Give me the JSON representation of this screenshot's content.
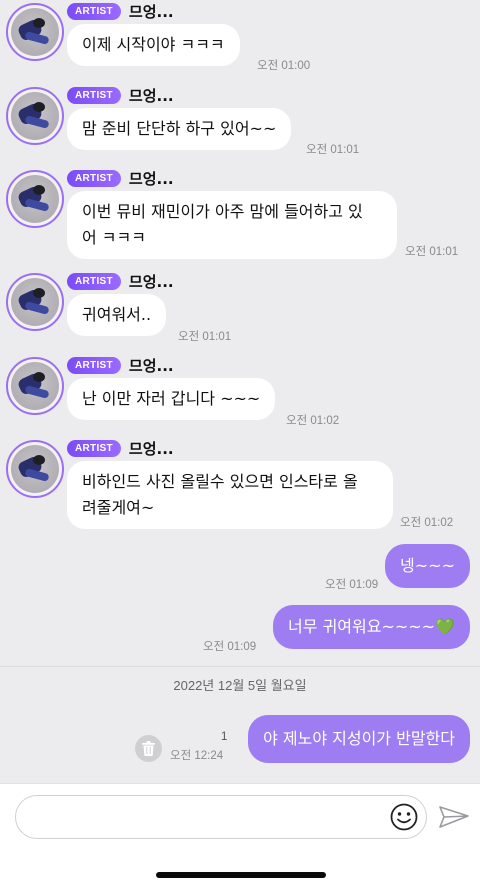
{
  "artist": {
    "badge": "ARTIST",
    "name": "므엉..."
  },
  "messages": [
    {
      "lines": [
        "이제 시작이야 ㅋㅋㅋ"
      ],
      "time": "오전 01:00"
    },
    {
      "lines": [
        "맘 준비 단단하 하구 있어~~"
      ],
      "time": "오전 01:01"
    },
    {
      "lines": [
        "이번 뮤비 재민이가 아주 맘에 들어하고 있",
        "어 ㅋㅋㅋ"
      ],
      "time": "오전 01:01"
    },
    {
      "lines": [
        "귀여워서.."
      ],
      "time": "오전 01:01"
    },
    {
      "lines": [
        "난 이만 자러 갑니다 ~~~"
      ],
      "time": "오전 01:02"
    },
    {
      "lines": [
        "비하인드 사진 올릴수 있으면 인스타로 올",
        "려줄게여~"
      ],
      "time": "오전 01:02"
    }
  ],
  "outgoing": [
    {
      "text": "넹~~~",
      "time": "오전 01:09"
    },
    {
      "text": "너무 귀여워요~~~~💚",
      "time": "오전 01:09"
    }
  ],
  "date_separator": "2022년 12월 5일 월요일",
  "pending": {
    "text": "야 제노야 지성이가 반말한다",
    "time": "오전 12:24",
    "unread": "1"
  },
  "composer": {
    "placeholder": "",
    "value": ""
  },
  "icons": {
    "emoji": "smiley-icon",
    "send": "paper-plane-icon",
    "delete": "trash-icon"
  },
  "colors": {
    "accent": "#9e7cf2",
    "badge": "#7b4cf5",
    "background": "#ececee"
  }
}
